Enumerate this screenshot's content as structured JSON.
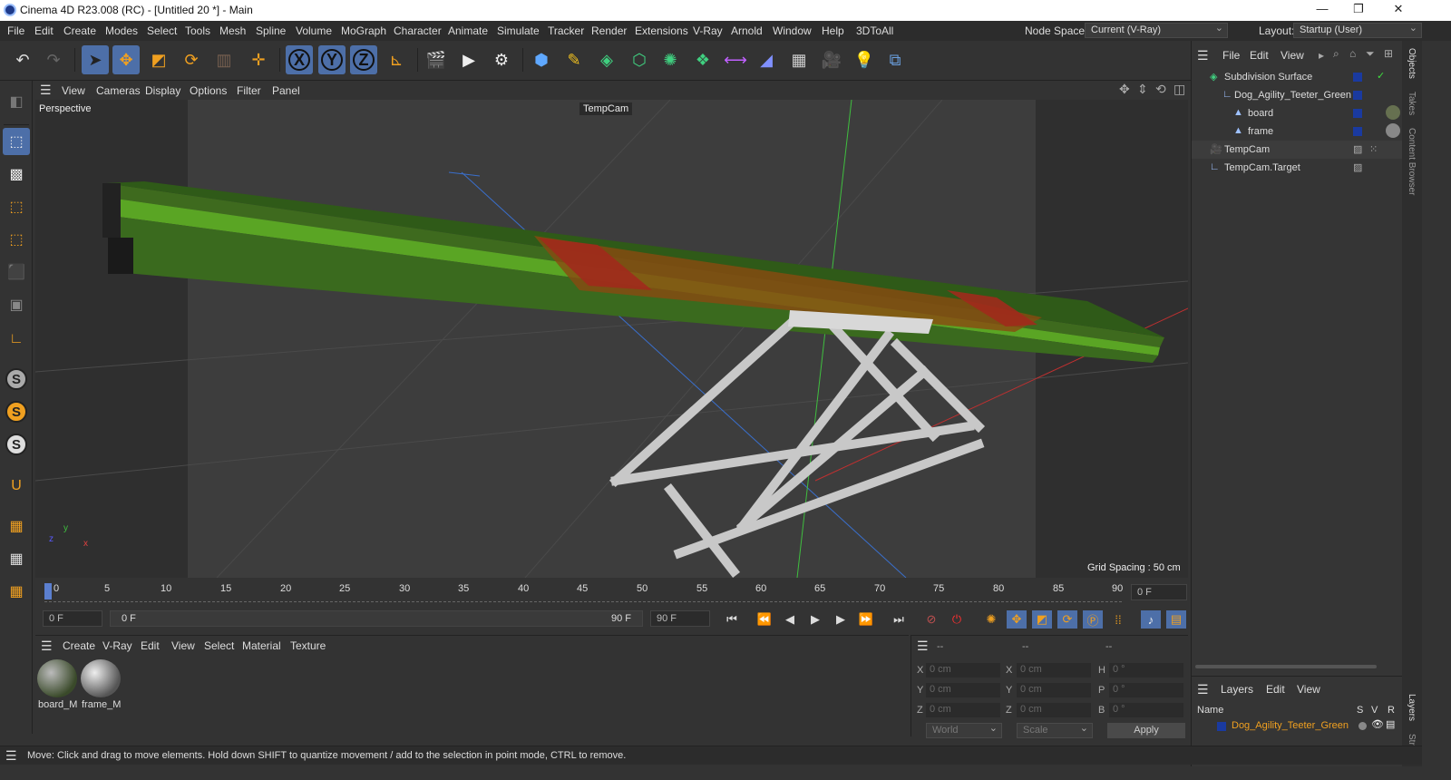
{
  "window": {
    "title": "Cinema 4D R23.008 (RC) - [Untitled 20 *] - Main",
    "minimize": "—",
    "restore": "❐",
    "close": "✕"
  },
  "menu": {
    "items": [
      "File",
      "Edit",
      "Create",
      "Modes",
      "Select",
      "Tools",
      "Mesh",
      "Spline",
      "Volume",
      "MoGraph",
      "Character",
      "Animate",
      "Simulate",
      "Tracker",
      "Render",
      "Extensions",
      "V-Ray",
      "Arnold",
      "Window",
      "Help",
      "3DToAll"
    ],
    "node_space_label": "Node Space:",
    "node_space_value": "Current (V-Ray)",
    "layout_label": "Layout:",
    "layout_value": "Startup (User)"
  },
  "toolbar": {
    "x": "X",
    "y": "Y",
    "z": "Z"
  },
  "left_tools": {
    "s1": "S",
    "s2": "S",
    "s3": "S"
  },
  "viewport": {
    "menu": [
      "View",
      "Cameras",
      "Display",
      "Options",
      "Filter",
      "Panel"
    ],
    "label": "Perspective",
    "camera": "TempCam",
    "grid_spacing": "Grid Spacing : 50 cm",
    "axis_x": "x",
    "axis_y": "y",
    "axis_z": "z"
  },
  "timeline": {
    "ticks": [
      "0",
      "5",
      "10",
      "15",
      "20",
      "25",
      "30",
      "35",
      "40",
      "45",
      "50",
      "55",
      "60",
      "65",
      "70",
      "75",
      "80",
      "85",
      "90"
    ],
    "current_frame": "0 F"
  },
  "playback": {
    "start": "0 F",
    "range_start": "0 F",
    "range_end": "90 F",
    "end": "90 F"
  },
  "materials": {
    "menu": [
      "Create",
      "V-Ray",
      "Edit",
      "View",
      "Select",
      "Material",
      "Texture"
    ],
    "items": [
      {
        "label": "board_M"
      },
      {
        "label": "frame_M"
      }
    ]
  },
  "coords": {
    "headers": [
      "--",
      "--",
      "--"
    ],
    "rows": [
      {
        "a": "X",
        "av": "0 cm",
        "b": "X",
        "bv": "0 cm",
        "c": "H",
        "cv": "0 °"
      },
      {
        "a": "Y",
        "av": "0 cm",
        "b": "Y",
        "bv": "0 cm",
        "c": "P",
        "cv": "0 °"
      },
      {
        "a": "Z",
        "av": "0 cm",
        "b": "Z",
        "bv": "0 cm",
        "c": "B",
        "cv": "0 °"
      }
    ],
    "world": "World",
    "scale": "Scale",
    "apply": "Apply"
  },
  "objects": {
    "menu": [
      "File",
      "Edit",
      "View"
    ],
    "items": [
      {
        "label": "Subdivision Surface"
      },
      {
        "label": "Dog_Agility_Teeter_Green"
      },
      {
        "label": "board"
      },
      {
        "label": "frame"
      },
      {
        "label": "TempCam"
      },
      {
        "label": "TempCam.Target"
      }
    ]
  },
  "layers": {
    "menu": [
      "Layers",
      "Edit",
      "View"
    ],
    "col_name": "Name",
    "col_s": "S",
    "col_v": "V",
    "col_r": "R",
    "item": "Dog_Agility_Teeter_Green"
  },
  "side_tabs": [
    "Objects",
    "Takes",
    "Content Browser"
  ],
  "side_tabs_bottom": [
    "Layers",
    "Str"
  ],
  "status": "Move: Click and drag to move elements. Hold down SHIFT to quantize movement / add to the selection in point mode, CTRL to remove."
}
